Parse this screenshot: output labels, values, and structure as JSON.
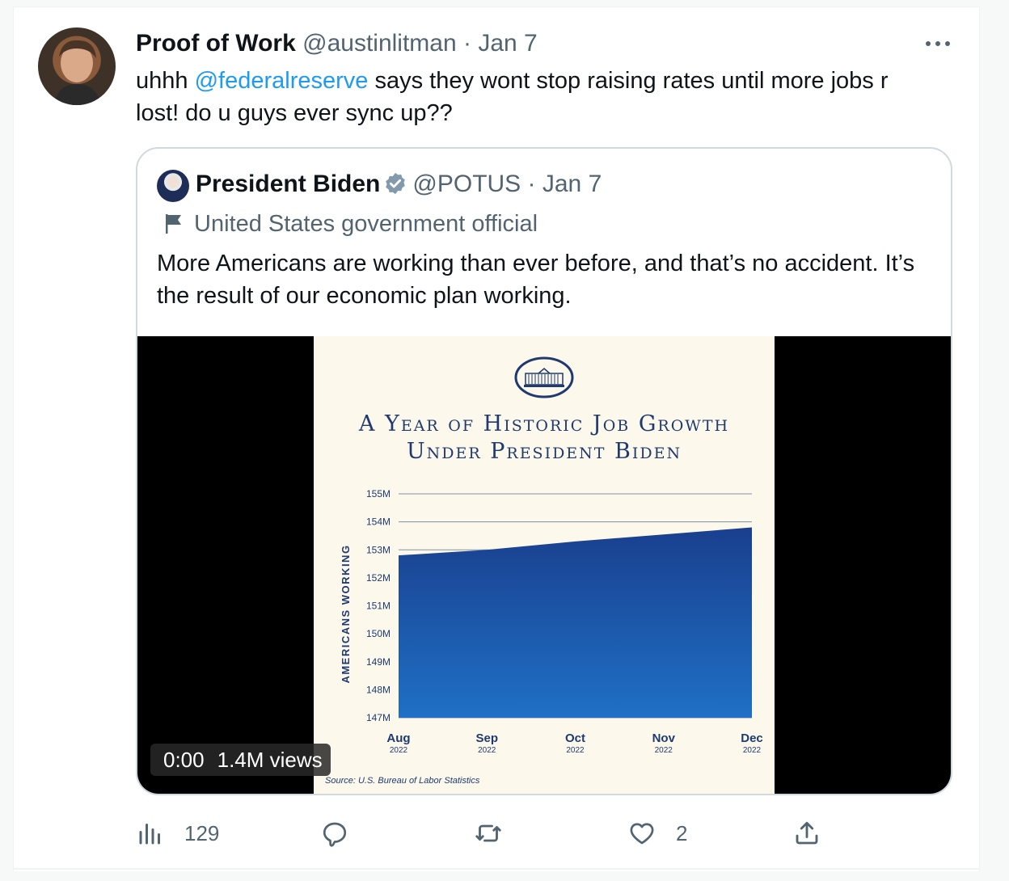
{
  "tweet": {
    "author_name": "Proof of Work",
    "handle": "@austinlitman",
    "date": "· Jan 7",
    "text_before": "uhhh ",
    "mention": "@federalreserve",
    "text_after": " says they wont stop raising rates until more jobs r lost! do u guys ever sync up??"
  },
  "quote": {
    "author_name": "President Biden",
    "handle": "@POTUS",
    "date": "· Jan 7",
    "label": "United States government official",
    "text": "More Americans are working than ever before, and that’s no accident. It’s the result of our economic plan working."
  },
  "media": {
    "time": "0:00",
    "views": "1.4M views",
    "title_line1": "A Year of Historic Job Growth",
    "title_line2": "Under President Biden",
    "source": "Source: U.S. Bureau of Labor Statistics"
  },
  "chart_data": {
    "type": "area",
    "title": "A Year of Historic Job Growth Under President Biden",
    "ylabel": "Americans Working",
    "categories": [
      "Aug",
      "Sep",
      "Oct",
      "Nov",
      "Dec"
    ],
    "category_years": [
      "2022",
      "2022",
      "2022",
      "2022",
      "2022"
    ],
    "values": [
      152.8,
      153.0,
      153.3,
      153.55,
      153.8
    ],
    "yticks": [
      "147M",
      "148M",
      "149M",
      "150M",
      "151M",
      "152M",
      "153M",
      "154M",
      "155M"
    ],
    "ylim": [
      147,
      155
    ],
    "grid": true,
    "colors": {
      "area_top": "#1a3f8e",
      "area_bottom": "#1f70c6",
      "text": "#1e3a70"
    }
  },
  "actions": {
    "views_count": "129",
    "reply_count": "",
    "retweet_count": "",
    "like_count": "2"
  },
  "colors": {
    "link": "#1d9bf0",
    "muted": "#536471",
    "verified": "#829aab"
  }
}
